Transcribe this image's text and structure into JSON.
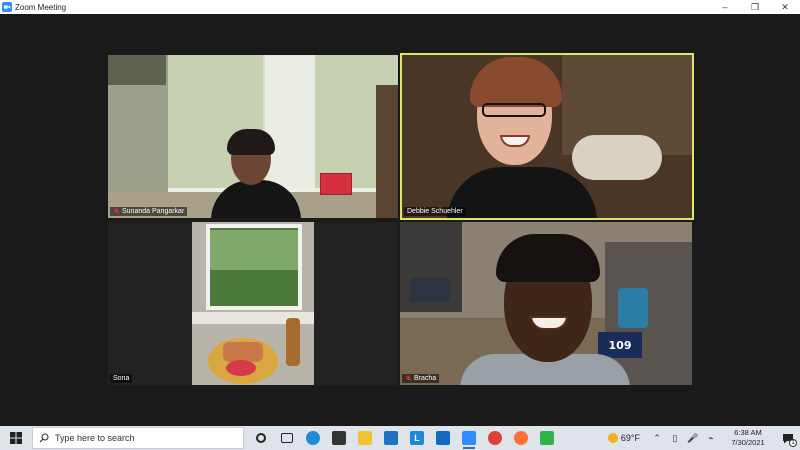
{
  "window": {
    "title": "Zoom Meeting",
    "controls": {
      "minimize": "–",
      "maximize": "❐",
      "close": "✕"
    }
  },
  "participants": [
    {
      "name": "Sunanda Pangarkar",
      "muted": true,
      "active_speaker": false
    },
    {
      "name": "Debbie Schuehler",
      "muted": false,
      "active_speaker": true
    },
    {
      "name": "Sona",
      "muted": false,
      "active_speaker": false
    },
    {
      "name": "Bracha",
      "muted": true,
      "active_speaker": false
    }
  ],
  "video_text": {
    "jersey_number": "109"
  },
  "taskbar": {
    "search_placeholder": "Type here to search",
    "apps": [
      {
        "icon": "cortana-icon",
        "color": "#222222"
      },
      {
        "icon": "task-view-icon",
        "color": "#222222"
      },
      {
        "icon": "edge-icon",
        "color": "#1f8ad6"
      },
      {
        "icon": "store-icon",
        "color": "#333333"
      },
      {
        "icon": "file-explorer-icon",
        "color": "#f2c230"
      },
      {
        "icon": "mail-icon",
        "color": "#1e73c8"
      },
      {
        "icon": "lync-icon",
        "color": "#1a8ad6",
        "label": "L"
      },
      {
        "icon": "outlook-icon",
        "color": "#0f6ac0"
      },
      {
        "icon": "zoom-icon",
        "color": "#2d8cff"
      },
      {
        "icon": "chrome-icon",
        "color": "#db4437"
      },
      {
        "icon": "firefox-icon",
        "color": "#ff7139"
      },
      {
        "icon": "upload-icon",
        "color": "#2fb34a"
      }
    ],
    "weather": "69°F",
    "time": "6:38 AM",
    "date": "7/30/2021",
    "notification_count": "1"
  },
  "colors": {
    "active_speaker_border": "#d9e86a",
    "muted_icon": "#e0303a",
    "taskbar_bg": "#dfe3ea"
  }
}
